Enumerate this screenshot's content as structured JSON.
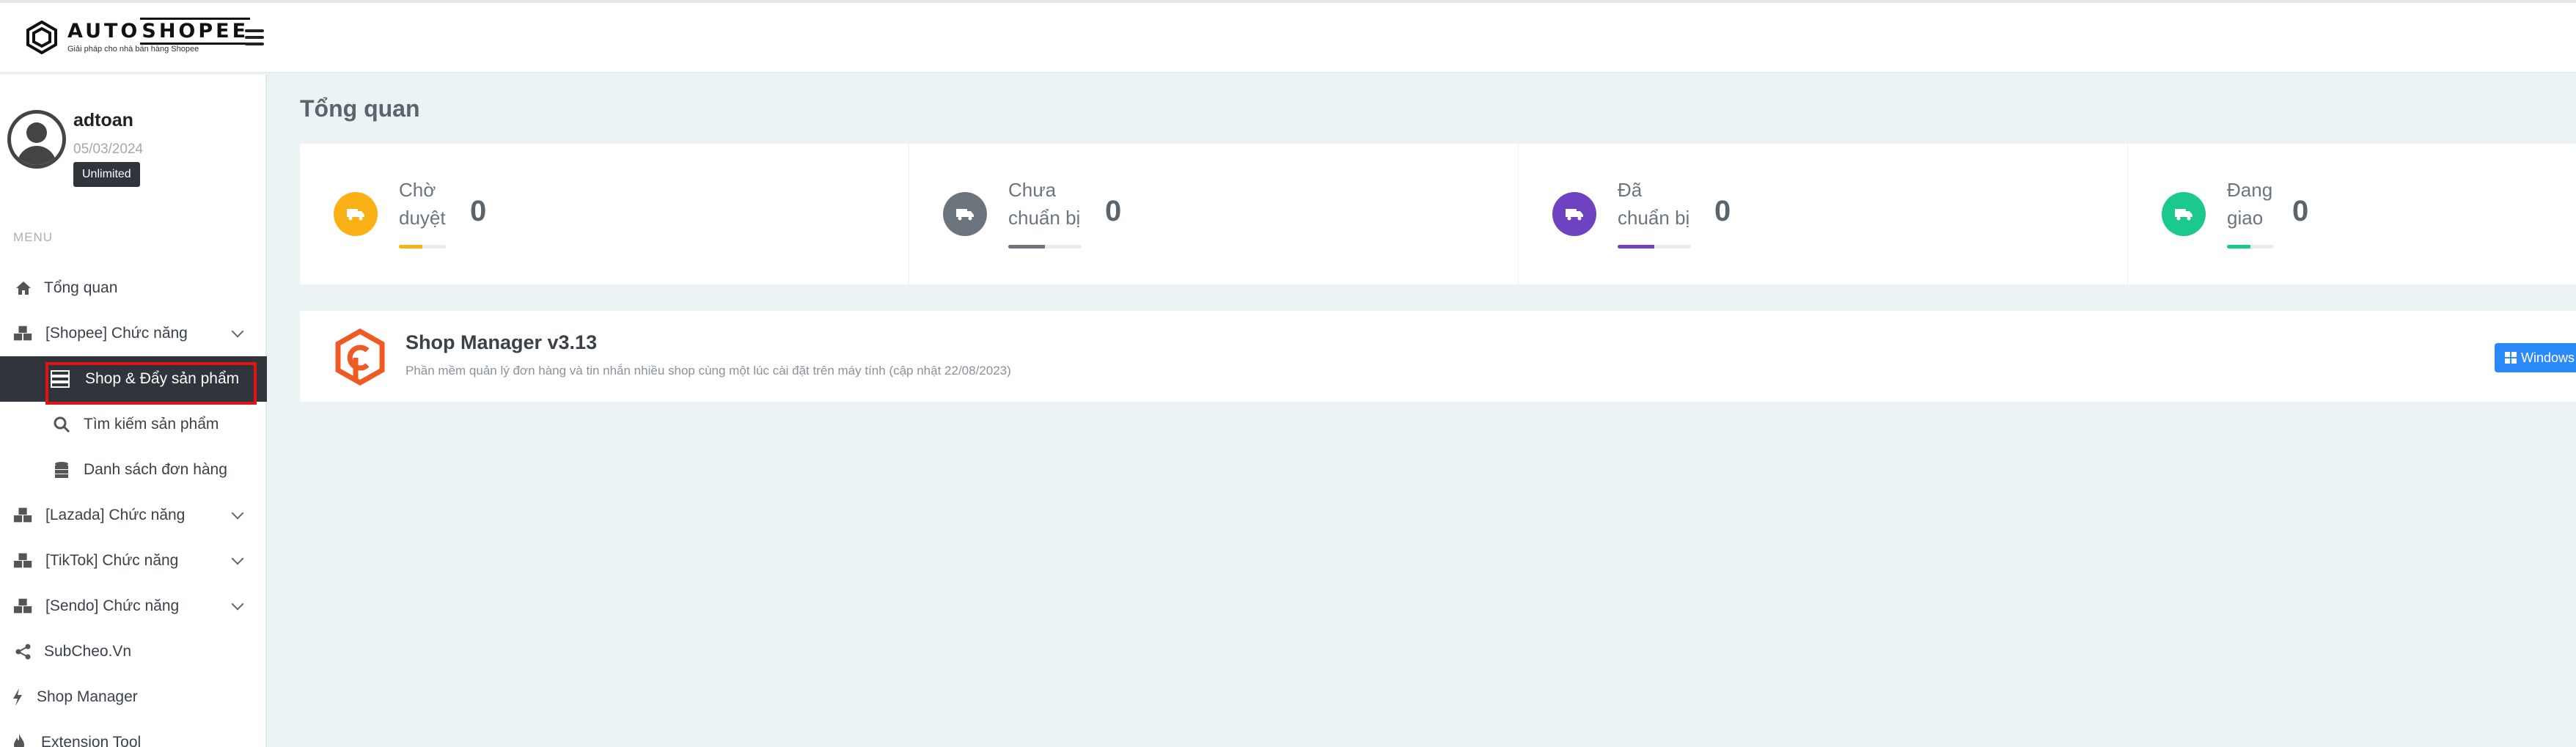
{
  "header": {
    "logo_prefix": "AUTO",
    "logo_brand": "SHOPEE",
    "logo_tagline": "Giải pháp cho nhà bán hàng Shopee",
    "menu_toggle_icon": "hamburger-icon"
  },
  "user": {
    "name": "adtoan",
    "date": "05/03/2024",
    "plan": "Unlimited"
  },
  "sidebar": {
    "menu_title": "MENU",
    "items": [
      {
        "label": "Tổng quan",
        "icon": "home-icon"
      },
      {
        "label": "[Shopee] Chức năng",
        "icon": "cubes-icon"
      },
      {
        "label": "Shop & Đẩy sản phẩm",
        "icon": "server-icon",
        "active": true
      },
      {
        "label": "Tìm kiếm sản phẩm",
        "icon": "search-icon"
      },
      {
        "label": "Danh sách đơn hàng",
        "icon": "database-icon"
      },
      {
        "label": "[Lazada] Chức năng",
        "icon": "cubes-icon"
      },
      {
        "label": "[TikTok] Chức năng",
        "icon": "cubes-icon"
      },
      {
        "label": "[Sendo] Chức năng",
        "icon": "cubes-icon"
      },
      {
        "label": "SubCheo.Vn",
        "icon": "share-icon"
      },
      {
        "label": "Shop Manager",
        "icon": "bolt-icon"
      },
      {
        "label": "Extension Tool",
        "icon": "fire-icon"
      }
    ]
  },
  "main": {
    "title": "Tổng quan"
  },
  "stats": [
    {
      "line1": "Chờ",
      "line2": "duyệt",
      "value": "0",
      "color": "#f9b115",
      "progress": 0.5
    },
    {
      "line1": "Chưa",
      "line2": "chuẩn bị",
      "value": "0",
      "color": "#6c757d",
      "progress": 0.5
    },
    {
      "line1": "Đã",
      "line2": "chuẩn bị",
      "value": "0",
      "color": "#6f42c1",
      "progress": 0.5
    },
    {
      "line1": "Đang",
      "line2": "giao",
      "value": "0",
      "color": "#1bc98e",
      "progress": 0.5
    }
  ],
  "app": {
    "name": "Shop Manager v3.13",
    "description": "Phần mềm quản lý đơn hàng và tin nhắn nhiều shop cùng một lúc cài đặt trên máy tính (cập nhật 22/08/2023)",
    "button": "Windows",
    "logo_color": "#f05a22"
  }
}
